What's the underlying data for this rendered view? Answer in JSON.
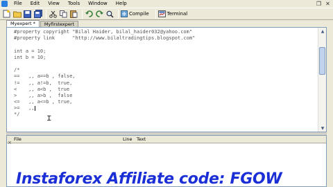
{
  "menubar": {
    "items": [
      "File",
      "Edit",
      "View",
      "Tools",
      "Window",
      "Help"
    ]
  },
  "toolbar": {
    "compile_label": "Compile",
    "terminal_label": "Terminal"
  },
  "tabs": [
    {
      "label": "Myexpert *",
      "active": true
    },
    {
      "label": "Myfirstexpert",
      "active": false
    }
  ],
  "editor": {
    "lines": [
      "#property copyright \"Bilal Haider, bilal_haider032@yahoo.com\"",
      "#property link      \"http://www.bilaltradingtips.blogspot.com\"",
      "",
      "int a = 10;",
      "int b = 10;",
      "",
      "/*",
      "==   ,, a==b , false,",
      "!=   ,, a!=b,  true,",
      "<    ,, a<b ,  true",
      ">    ,, a>b ,  false",
      "<=   ,, a<=b , true,",
      ">=   ,,",
      "*/"
    ]
  },
  "bottom_panel": {
    "columns": [
      "File",
      "Line",
      "Text"
    ]
  },
  "banner": {
    "text": "Instaforex Affiliate code: FGOW"
  },
  "colors": {
    "banner": "#1b2fd6",
    "code_text": "#555555"
  }
}
